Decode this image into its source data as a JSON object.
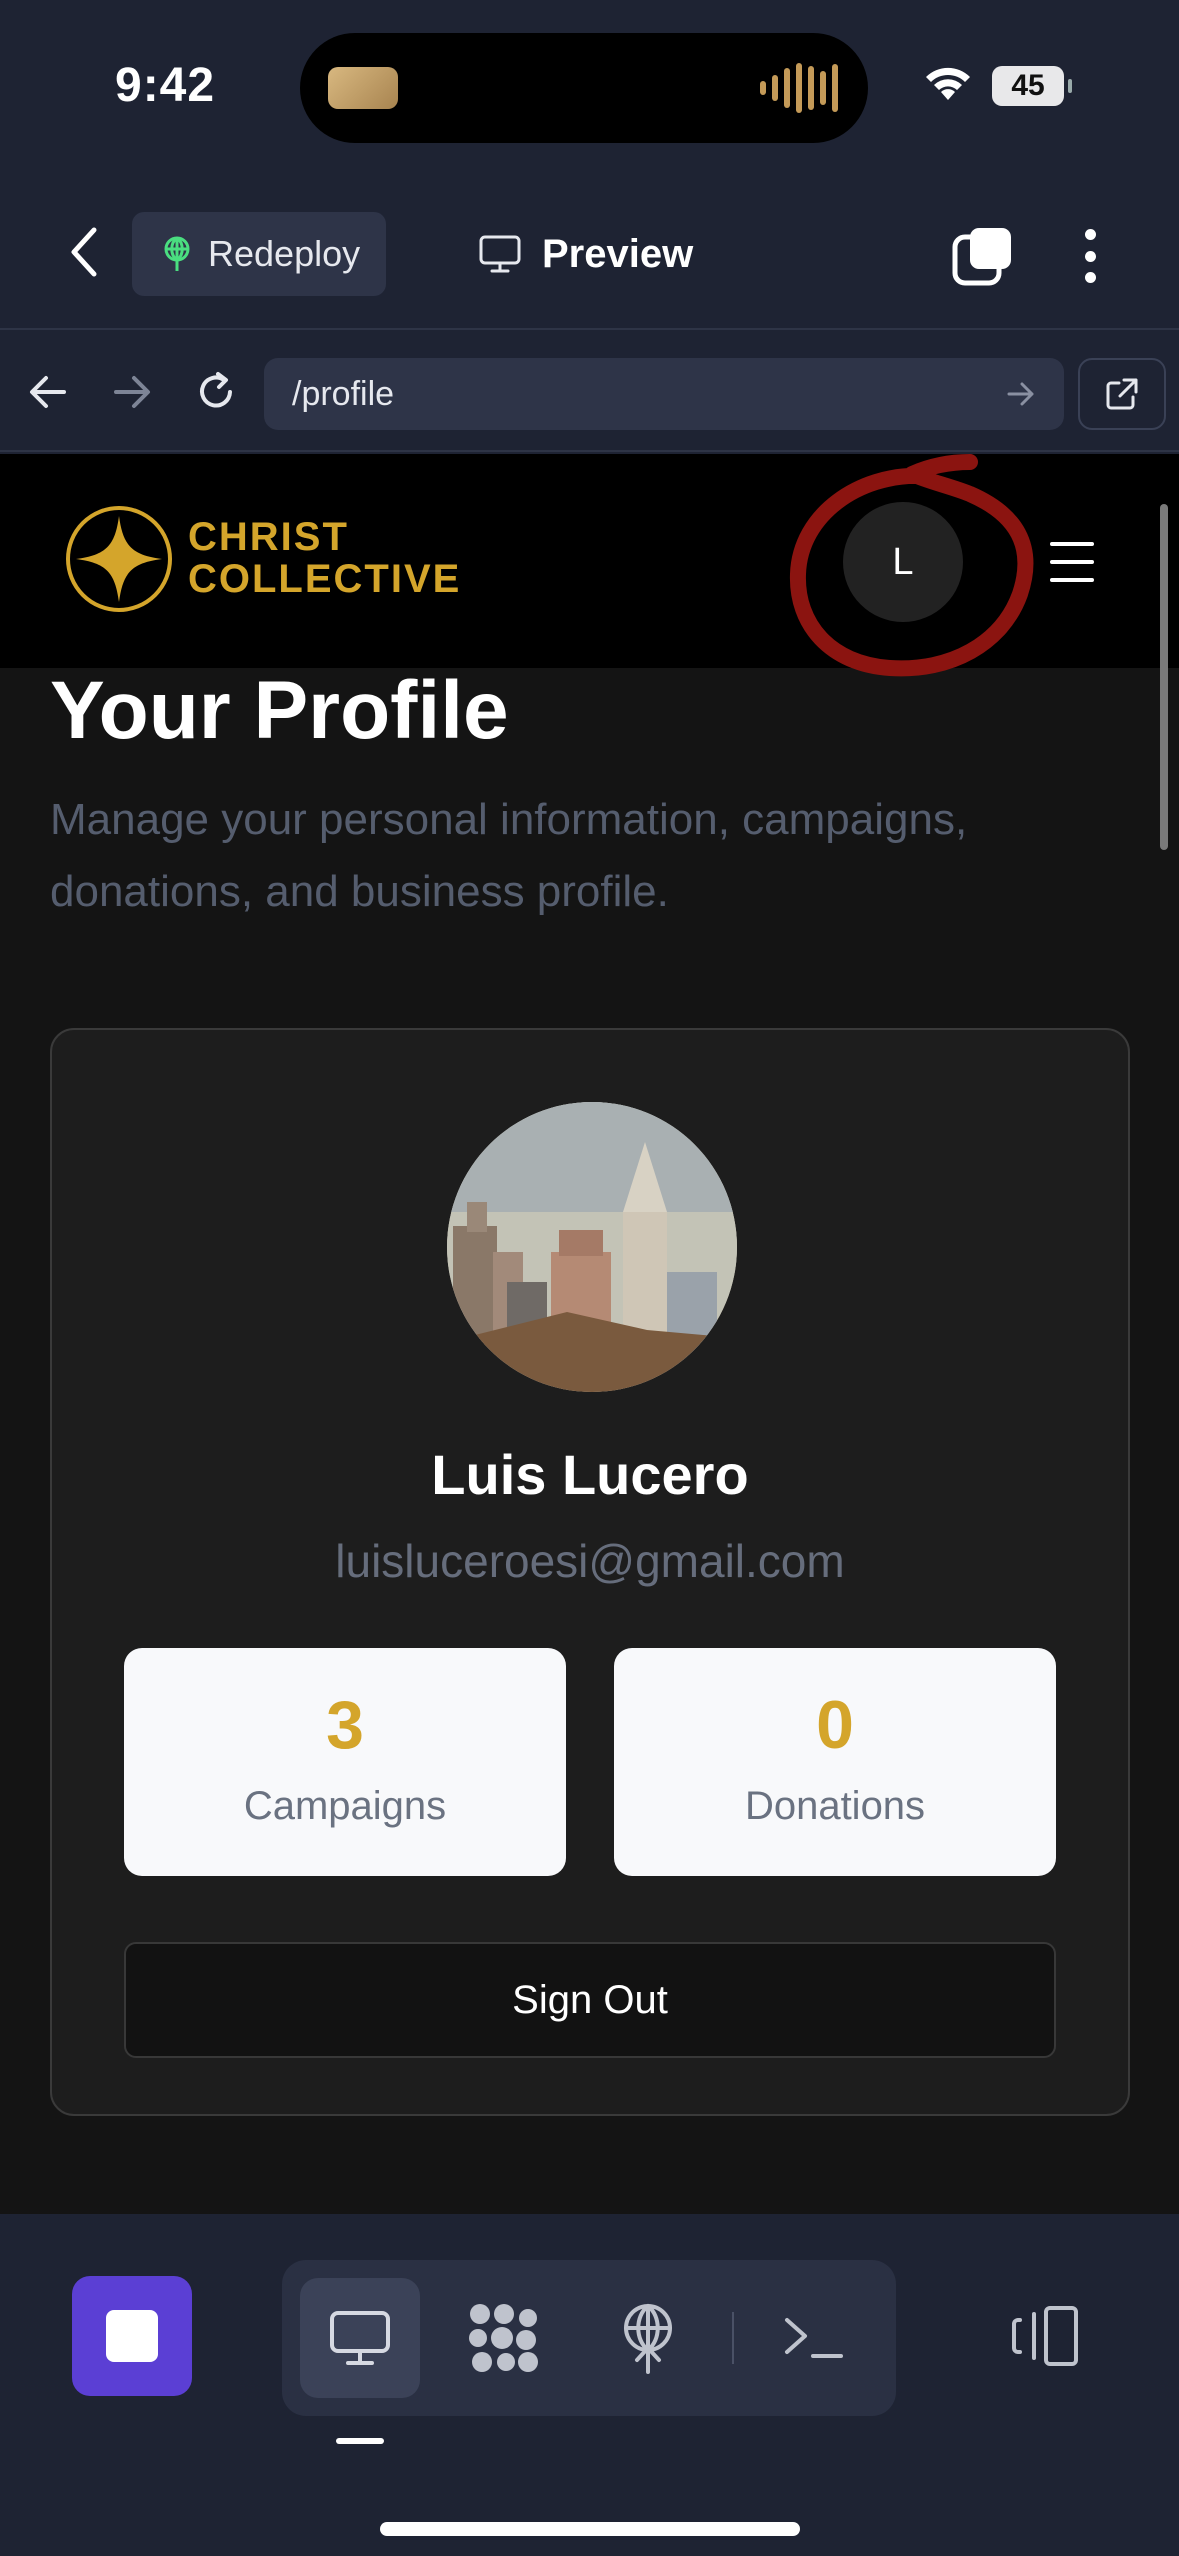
{
  "status_bar": {
    "time": "9:42",
    "battery": "45"
  },
  "toolbar": {
    "redeploy_label": "Redeploy",
    "preview_label": "Preview"
  },
  "browser": {
    "url": "/profile"
  },
  "site": {
    "logo_line1": "CHRIST",
    "logo_line2": "COLLECTIVE",
    "avatar_initial": "L",
    "brand_color": "#d4a52b"
  },
  "profile": {
    "title": "Your Profile",
    "subtitle": "Manage your personal information, campaigns, donations, and business profile.",
    "name": "Luis Lucero",
    "email": "luisluceroesi@gmail.com",
    "stats": {
      "campaigns_count": "3",
      "campaigns_label": "Campaigns",
      "donations_count": "0",
      "donations_label": "Donations"
    },
    "sign_out_label": "Sign Out"
  },
  "bottom_bar": {
    "tabs": [
      "monitor-icon",
      "grid-dots-icon",
      "deploy-icon",
      "terminal-icon"
    ],
    "active_tab": "monitor-icon",
    "accent_color": "#5b3fd4"
  }
}
